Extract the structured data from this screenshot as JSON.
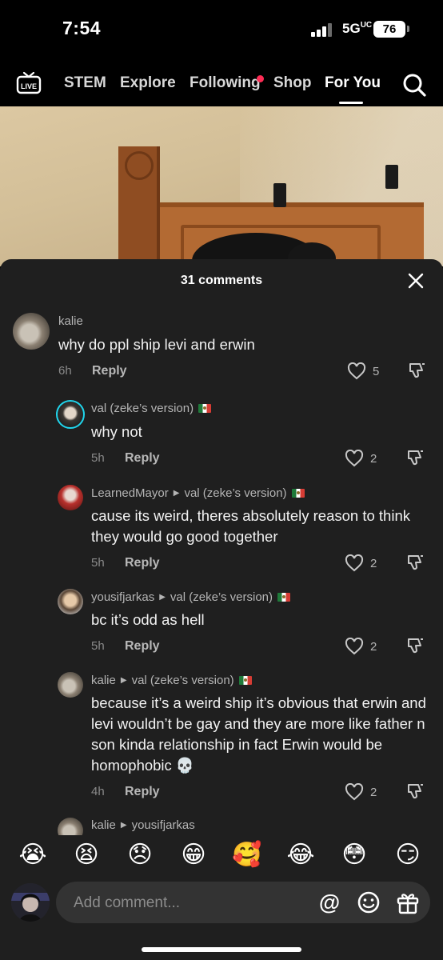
{
  "status_bar": {
    "time": "7:54",
    "network": "5G",
    "battery": "76"
  },
  "nav": {
    "tabs": [
      "STEM",
      "Explore",
      "Following",
      "Shop",
      "For You"
    ],
    "active_tab": "For You"
  },
  "comments_sheet": {
    "title": "31 comments",
    "comments": [
      {
        "user": "kalie",
        "reply_to": "",
        "text": "why do ppl ship levi and erwin",
        "time": "6h",
        "reply_label": "Reply",
        "likes": "5"
      },
      {
        "user": "val (zeke’s version)",
        "reply_to": "",
        "text": "why not",
        "time": "5h",
        "reply_label": "Reply",
        "likes": "2"
      },
      {
        "user": "LearnedMayor",
        "reply_to": "val (zeke’s version)",
        "text": "cause its weird, theres absolutely reason to think they would go good together",
        "time": "5h",
        "reply_label": "Reply",
        "likes": "2"
      },
      {
        "user": "yousifjarkas",
        "reply_to": "val (zeke’s version)",
        "text": "bc it’s odd as hell",
        "time": "5h",
        "reply_label": "Reply",
        "likes": "2"
      },
      {
        "user": "kalie",
        "reply_to": "val (zeke’s version)",
        "text": "because it’s a weird ship it’s obvious that erwin and levi wouldn’t be gay and they are more like father n son kinda relationship in fact Erwin would be homophobic 💀",
        "time": "4h",
        "reply_label": "Reply",
        "likes": "2"
      },
      {
        "user": "kalie",
        "reply_to": "yousifjarkas",
        "text": "",
        "time": "",
        "reply_label": "",
        "likes": ""
      }
    ]
  },
  "emojis": [
    "😭",
    "😫",
    "😞",
    "😁",
    "🥰",
    "😂",
    "😳",
    "😏"
  ],
  "composer": {
    "placeholder": "Add comment..."
  },
  "colors": {
    "accent": "#fe2c55",
    "sheet_bg": "#1f1f1f",
    "input_bg": "#333333"
  }
}
